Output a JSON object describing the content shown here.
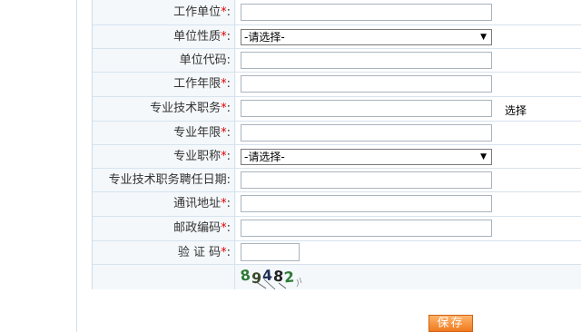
{
  "form": {
    "fields": [
      {
        "label": "工作单位",
        "required": "*",
        "colon": ":",
        "type": "text",
        "value": ""
      },
      {
        "label": "单位性质",
        "required": "*",
        "colon": ":",
        "type": "select",
        "value": "-请选择-"
      },
      {
        "label": "单位代码",
        "required": "",
        "colon": ":",
        "type": "text",
        "value": ""
      },
      {
        "label": "工作年限",
        "required": "*",
        "colon": ":",
        "type": "text",
        "value": ""
      },
      {
        "label": "专业技术职务",
        "required": "*",
        "colon": ":",
        "type": "text",
        "value": "",
        "action": "选择"
      },
      {
        "label": "专业年限",
        "required": "*",
        "colon": ":",
        "type": "text",
        "value": ""
      },
      {
        "label": "专业职称",
        "required": "*",
        "colon": ":",
        "type": "select",
        "value": "-请选择-"
      },
      {
        "label": "专业技术职务聘任日期",
        "required": "",
        "colon": ":",
        "type": "text",
        "value": ""
      },
      {
        "label": "通讯地址",
        "required": "*",
        "colon": ":",
        "type": "text",
        "value": ""
      },
      {
        "label": "邮政编码",
        "required": "*",
        "colon": ":",
        "type": "text",
        "value": ""
      },
      {
        "label": "验 证 码",
        "required": "*",
        "colon": ":",
        "type": "captcha",
        "value": ""
      }
    ],
    "captcha_text": "89482",
    "save_label": "保存"
  },
  "colors": {
    "required": "#e00000",
    "row_background": "#f4f8fb",
    "save_button": "#f07a1e"
  },
  "icons": {
    "select_arrow": "dropdown-arrow-icon"
  }
}
